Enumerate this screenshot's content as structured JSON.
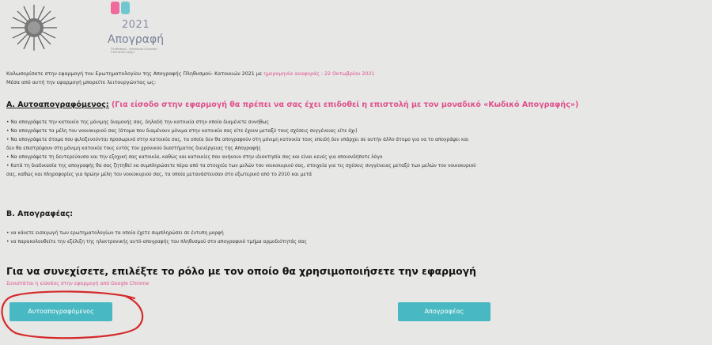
{
  "header": {
    "logo_year": "2021",
    "logo_name": "Απογραφή",
    "logo_sub": "Πληθυσμού - Κατοικιών Ελληνική Στατιστική Αρχή"
  },
  "intro": {
    "line1_a": "Καλωσορίσατε στην εφαρμογή του Ερωτηματολογίου της Απογραφής Πληθυσμού- Κατοικιών 2021 με",
    "line1_b": "ημερομηνία αναφοράς : 22 Οκτωβρίου 2021",
    "line2": "Μέσα από αυτή την εφαρμογή μπορείτε λειτουργώντας ως:"
  },
  "section_a": {
    "title": "Α. Αυτοαπογραφόμενος:",
    "note": "(Για είσοδο στην εφαρμογή θα πρέπει να σας έχει επιδοθεί η επιστολή με τον μοναδικό «Κωδικό Απογραφής»)",
    "bullets": [
      "• Να απογράψετε την κατοικία της μόνιμης διαμονής σας, δηλαδή την κατοικία στην οποία διαμένετε συνήθως",
      "• Να απογράψετε τα μέλη του νοικοκυριού σας (άτομα που διαμένουν μόνιμα στην κατοικία σας είτε έχουν μεταξύ τους σχέσεις συγγένειας είτε όχι)",
      "• Να απογράψετε άτομα που φιλοξενούνται προσωρινά στην κατοικία σας, τα οποία δεν θα απογραφούν στη μόνιμη κατοικία τους επειδή δεν υπάρχει σε αυτήν άλλο άτομο για να το απογράψει και",
      "δεν θα επιστρέψουν στη μόνιμη κατοικία τους εντός του χρονικού διαστήματος διενέργειας της Απογραφής",
      "• Να απογράψετε τη δευτερεύουσα και την εξοχική σας κατοικία, καθώς και κατοικίες που ανήκουν στην ιδιοκτησία σας και είναι κενές για οποιονδήποτε λόγο",
      "• Κατά τη διαδικασία της απογραφής θα σας ζητηθεί να συμπληρώσετε πέρα από τα στοιχεία των μελών του νοικοκυριού σας, στοιχεία για τις σχέσεις συγγένειας μεταξύ των μελών του νοικοκυριού",
      "σας, καθώς και πληροφορίες για πρώην μέλη του νοικοκυριού σας, τα οποία μετανάστευσαν στο εξωτερικό από το 2010 και μετά"
    ]
  },
  "section_b": {
    "title": "Β. Απογραφέας:",
    "bullets": [
      "• να κάνετε εισαγωγή των ερωτηματολογίων τα οποία έχετε συμπληρώσει σε έντυπη μορφή",
      "• να παρακολουθείτε την εξέλιξη της ηλεκτρονικής αυτό-απογραφής του πληθυσμού στο απογραφικό τμήμα αρμοδιότητάς σας"
    ]
  },
  "prompt": "Για να συνεχίσετε, επιλέξτε το ρόλο με τον οποίο θα χρησιμοποιήσετε την εφαρμογή",
  "chrome_note": "Συνιστάται η είσοδος στην εφαρμογή από Google Chrome",
  "buttons": {
    "self_enum": "Αυτοαπογραφόμενος",
    "enumerator": "Απογραφέας"
  },
  "colors": {
    "accent_pink": "#e0508a",
    "button_teal": "#48b8c2",
    "annotation_red": "#d42a2a"
  }
}
